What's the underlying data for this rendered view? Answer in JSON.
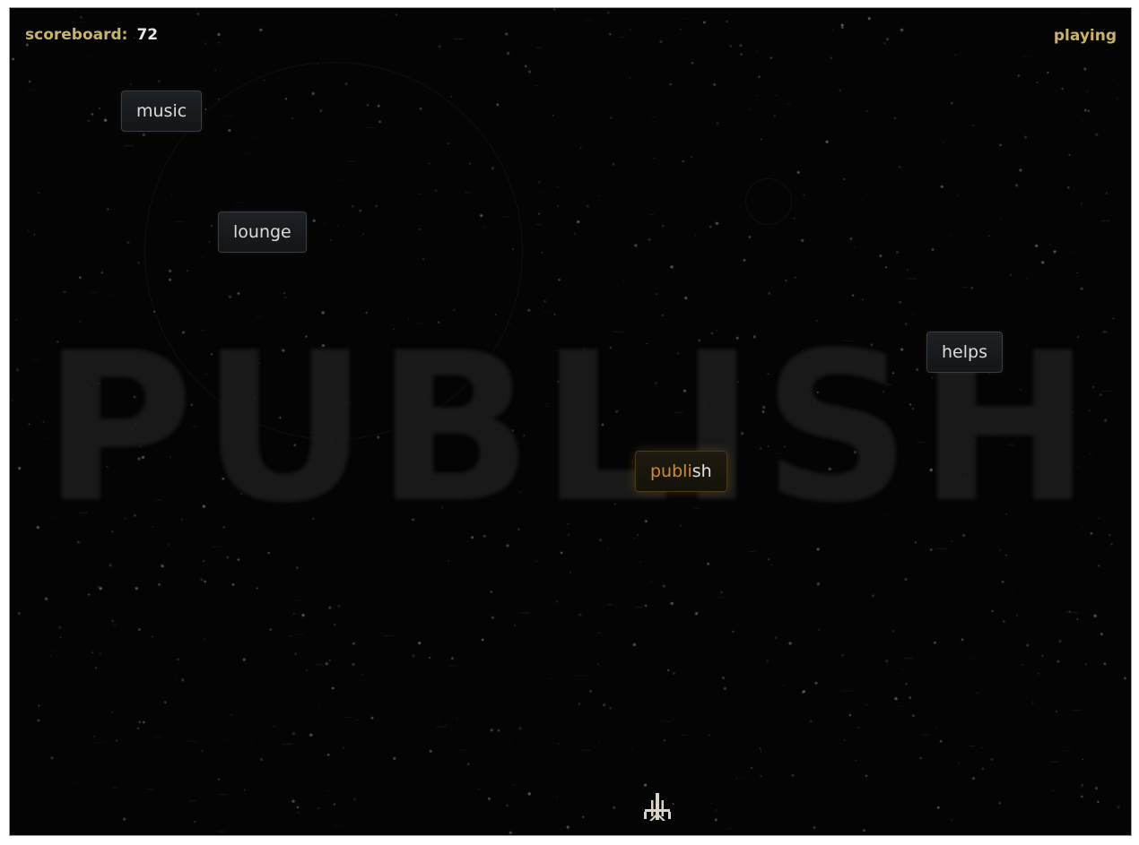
{
  "hud": {
    "score_label": "scoreboard:",
    "score_value": "72",
    "status": "playing"
  },
  "target_word_background": "PUBLISH",
  "words": [
    {
      "id": "music",
      "text": "music"
    },
    {
      "id": "lounge",
      "text": "lounge"
    },
    {
      "id": "helps",
      "text": "helps"
    },
    {
      "id": "publish",
      "typed": "publi",
      "rest": "sh",
      "active": true
    }
  ],
  "player": {
    "icon": "ship-icon"
  },
  "colors": {
    "background": "#040404",
    "hud_label": "#c8b36a",
    "typed_letters": "#d08c2e",
    "word_text": "#dcdcdc"
  }
}
